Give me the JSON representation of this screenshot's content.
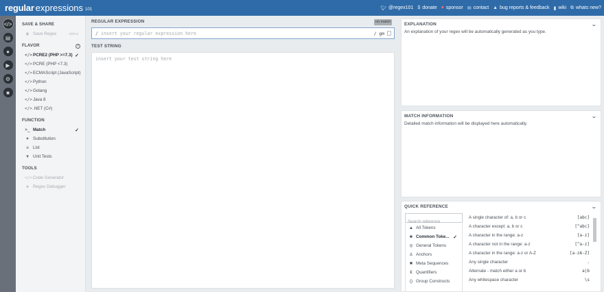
{
  "app": {
    "logo_main": "regular",
    "logo_rest": "expressions",
    "logo_suffix": "101"
  },
  "topnav": [
    {
      "icon": "twitter-icon",
      "label": "@regex101"
    },
    {
      "icon": "dollar-icon",
      "label": "donate"
    },
    {
      "icon": "heart-icon",
      "label": "sponsor"
    },
    {
      "icon": "mail-icon",
      "label": "contact"
    },
    {
      "icon": "bug-icon",
      "label": "bug reports & feedback"
    },
    {
      "icon": "book-icon",
      "label": "wiki"
    },
    {
      "icon": "external-link-icon",
      "label": "whats new?"
    }
  ],
  "rail": [
    "code-icon",
    "library-icon",
    "user-icon",
    "video-icon",
    "settings-icon",
    "chat-icon"
  ],
  "sidebar": {
    "save_share": {
      "title": "SAVE & SHARE",
      "save_regex": "Save Regex",
      "shortcut": "ctrl+s"
    },
    "flavor": {
      "title": "FLAVOR",
      "items": [
        {
          "label": "PCRE2 (PHP >=7.3)",
          "selected": true
        },
        {
          "label": "PCRE (PHP <7.3)"
        },
        {
          "label": "ECMAScript (JavaScript)"
        },
        {
          "label": "Python"
        },
        {
          "label": "Golang"
        },
        {
          "label": "Java 8"
        },
        {
          "label": ".NET (C#)"
        }
      ]
    },
    "function": {
      "title": "FUNCTION",
      "items": [
        {
          "label": "Match",
          "selected": true
        },
        {
          "label": "Substitution"
        },
        {
          "label": "List"
        },
        {
          "label": "Unit Tests"
        }
      ]
    },
    "tools": {
      "title": "TOOLS",
      "items": [
        {
          "label": "Code Generator"
        },
        {
          "label": "Regex Debugger"
        }
      ]
    }
  },
  "editor": {
    "regex_title": "REGULAR EXPRESSION",
    "match_badge": "no match",
    "delimiter": "/",
    "regex_placeholder": "insert your regular expression here",
    "flags": "/ gm",
    "test_title": "TEST STRING",
    "test_placeholder": "insert your test string here"
  },
  "explanation": {
    "title": "EXPLANATION",
    "body": "An explanation of your regex will be automatically generated as you type."
  },
  "match_info": {
    "title": "MATCH INFORMATION",
    "body": "Detailed match information will be displayed here automatically."
  },
  "quick_reference": {
    "title": "QUICK REFERENCE",
    "search_placeholder": "Search reference",
    "categories": [
      {
        "icon": "all-tokens-icon",
        "label": "All Tokens"
      },
      {
        "icon": "star-icon",
        "label": "Common Toke...",
        "selected": true
      },
      {
        "icon": "general-tokens-icon",
        "label": "General Tokens"
      },
      {
        "icon": "anchor-icon",
        "label": "Anchors"
      },
      {
        "icon": "meta-sequences-icon",
        "label": "Meta Sequences"
      },
      {
        "icon": "quantifiers-icon",
        "label": "Quantifiers"
      },
      {
        "icon": "group-constructs-icon",
        "label": "Group Constructs"
      }
    ],
    "rows": [
      {
        "desc": "A single character of: a, b or c",
        "token": "[abc]"
      },
      {
        "desc": "A character except: a, b or c",
        "token": "[^abc]"
      },
      {
        "desc": "A character in the range: a-z",
        "token": "[a-z]"
      },
      {
        "desc": "A character not in the range: a-z",
        "token": "[^a-z]"
      },
      {
        "desc": "A character in the range: a-z or A-Z",
        "token": "[a-zA-Z]"
      },
      {
        "desc": "Any single character",
        "token": "."
      },
      {
        "desc": "Alternate - match either a or b",
        "token": "a|b"
      },
      {
        "desc": "Any whitespace character",
        "token": "\\s"
      }
    ]
  }
}
